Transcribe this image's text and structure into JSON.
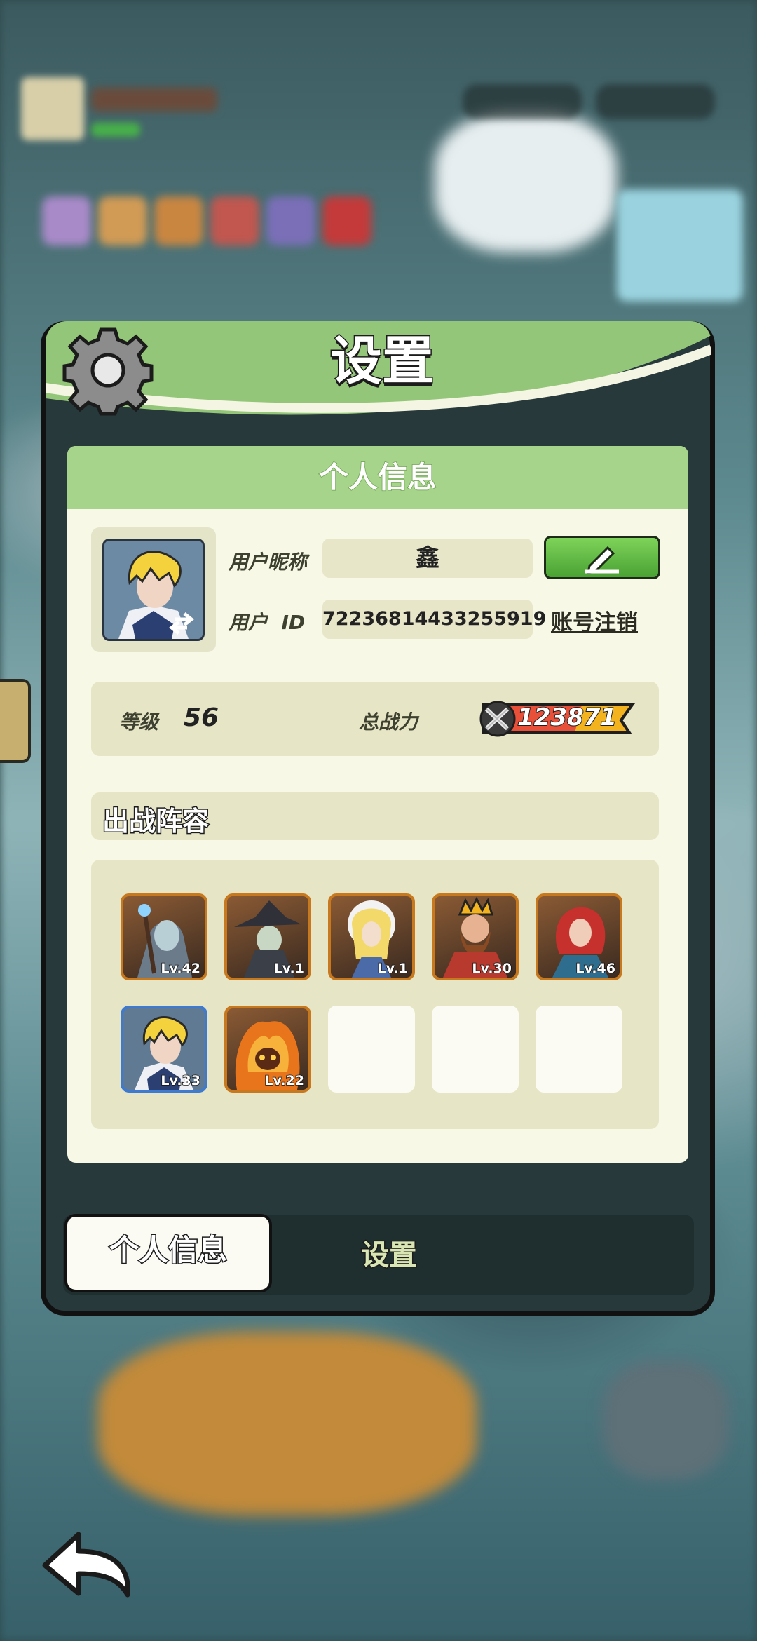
{
  "dialog": {
    "title": "设置",
    "section_title": "个人信息"
  },
  "profile": {
    "nickname_label": "用户昵称",
    "nickname": "鑫",
    "id_label": "用户  ID",
    "user_id": "72236814433255919",
    "cancel_account": "账号注销"
  },
  "stats": {
    "level_label": "等级",
    "level": "56",
    "power_label": "总战力",
    "power": "123871"
  },
  "lineup": {
    "title": "出战阵容",
    "heroes": [
      {
        "level": "Lv.42",
        "frame": "orange"
      },
      {
        "level": "Lv.1",
        "frame": "orange"
      },
      {
        "level": "Lv.1",
        "frame": "orange"
      },
      {
        "level": "Lv.30",
        "frame": "orange"
      },
      {
        "level": "Lv.46",
        "frame": "orange"
      },
      {
        "level": "Lv.33",
        "frame": "blue"
      },
      {
        "level": "Lv.22",
        "frame": "orange"
      }
    ],
    "empty_slots": 3
  },
  "tabs": [
    {
      "label": "个人信息",
      "active": true
    },
    {
      "label": "设置",
      "active": false
    }
  ],
  "icons": {
    "header": "gear-icon",
    "edit": "pencil-icon",
    "power": "crossed-swords-icon",
    "back": "back-arrow-icon"
  },
  "colors": {
    "header_green": "#a6d48b",
    "edit_button": "#5bb63d",
    "power_badge": "#f2b31f"
  }
}
